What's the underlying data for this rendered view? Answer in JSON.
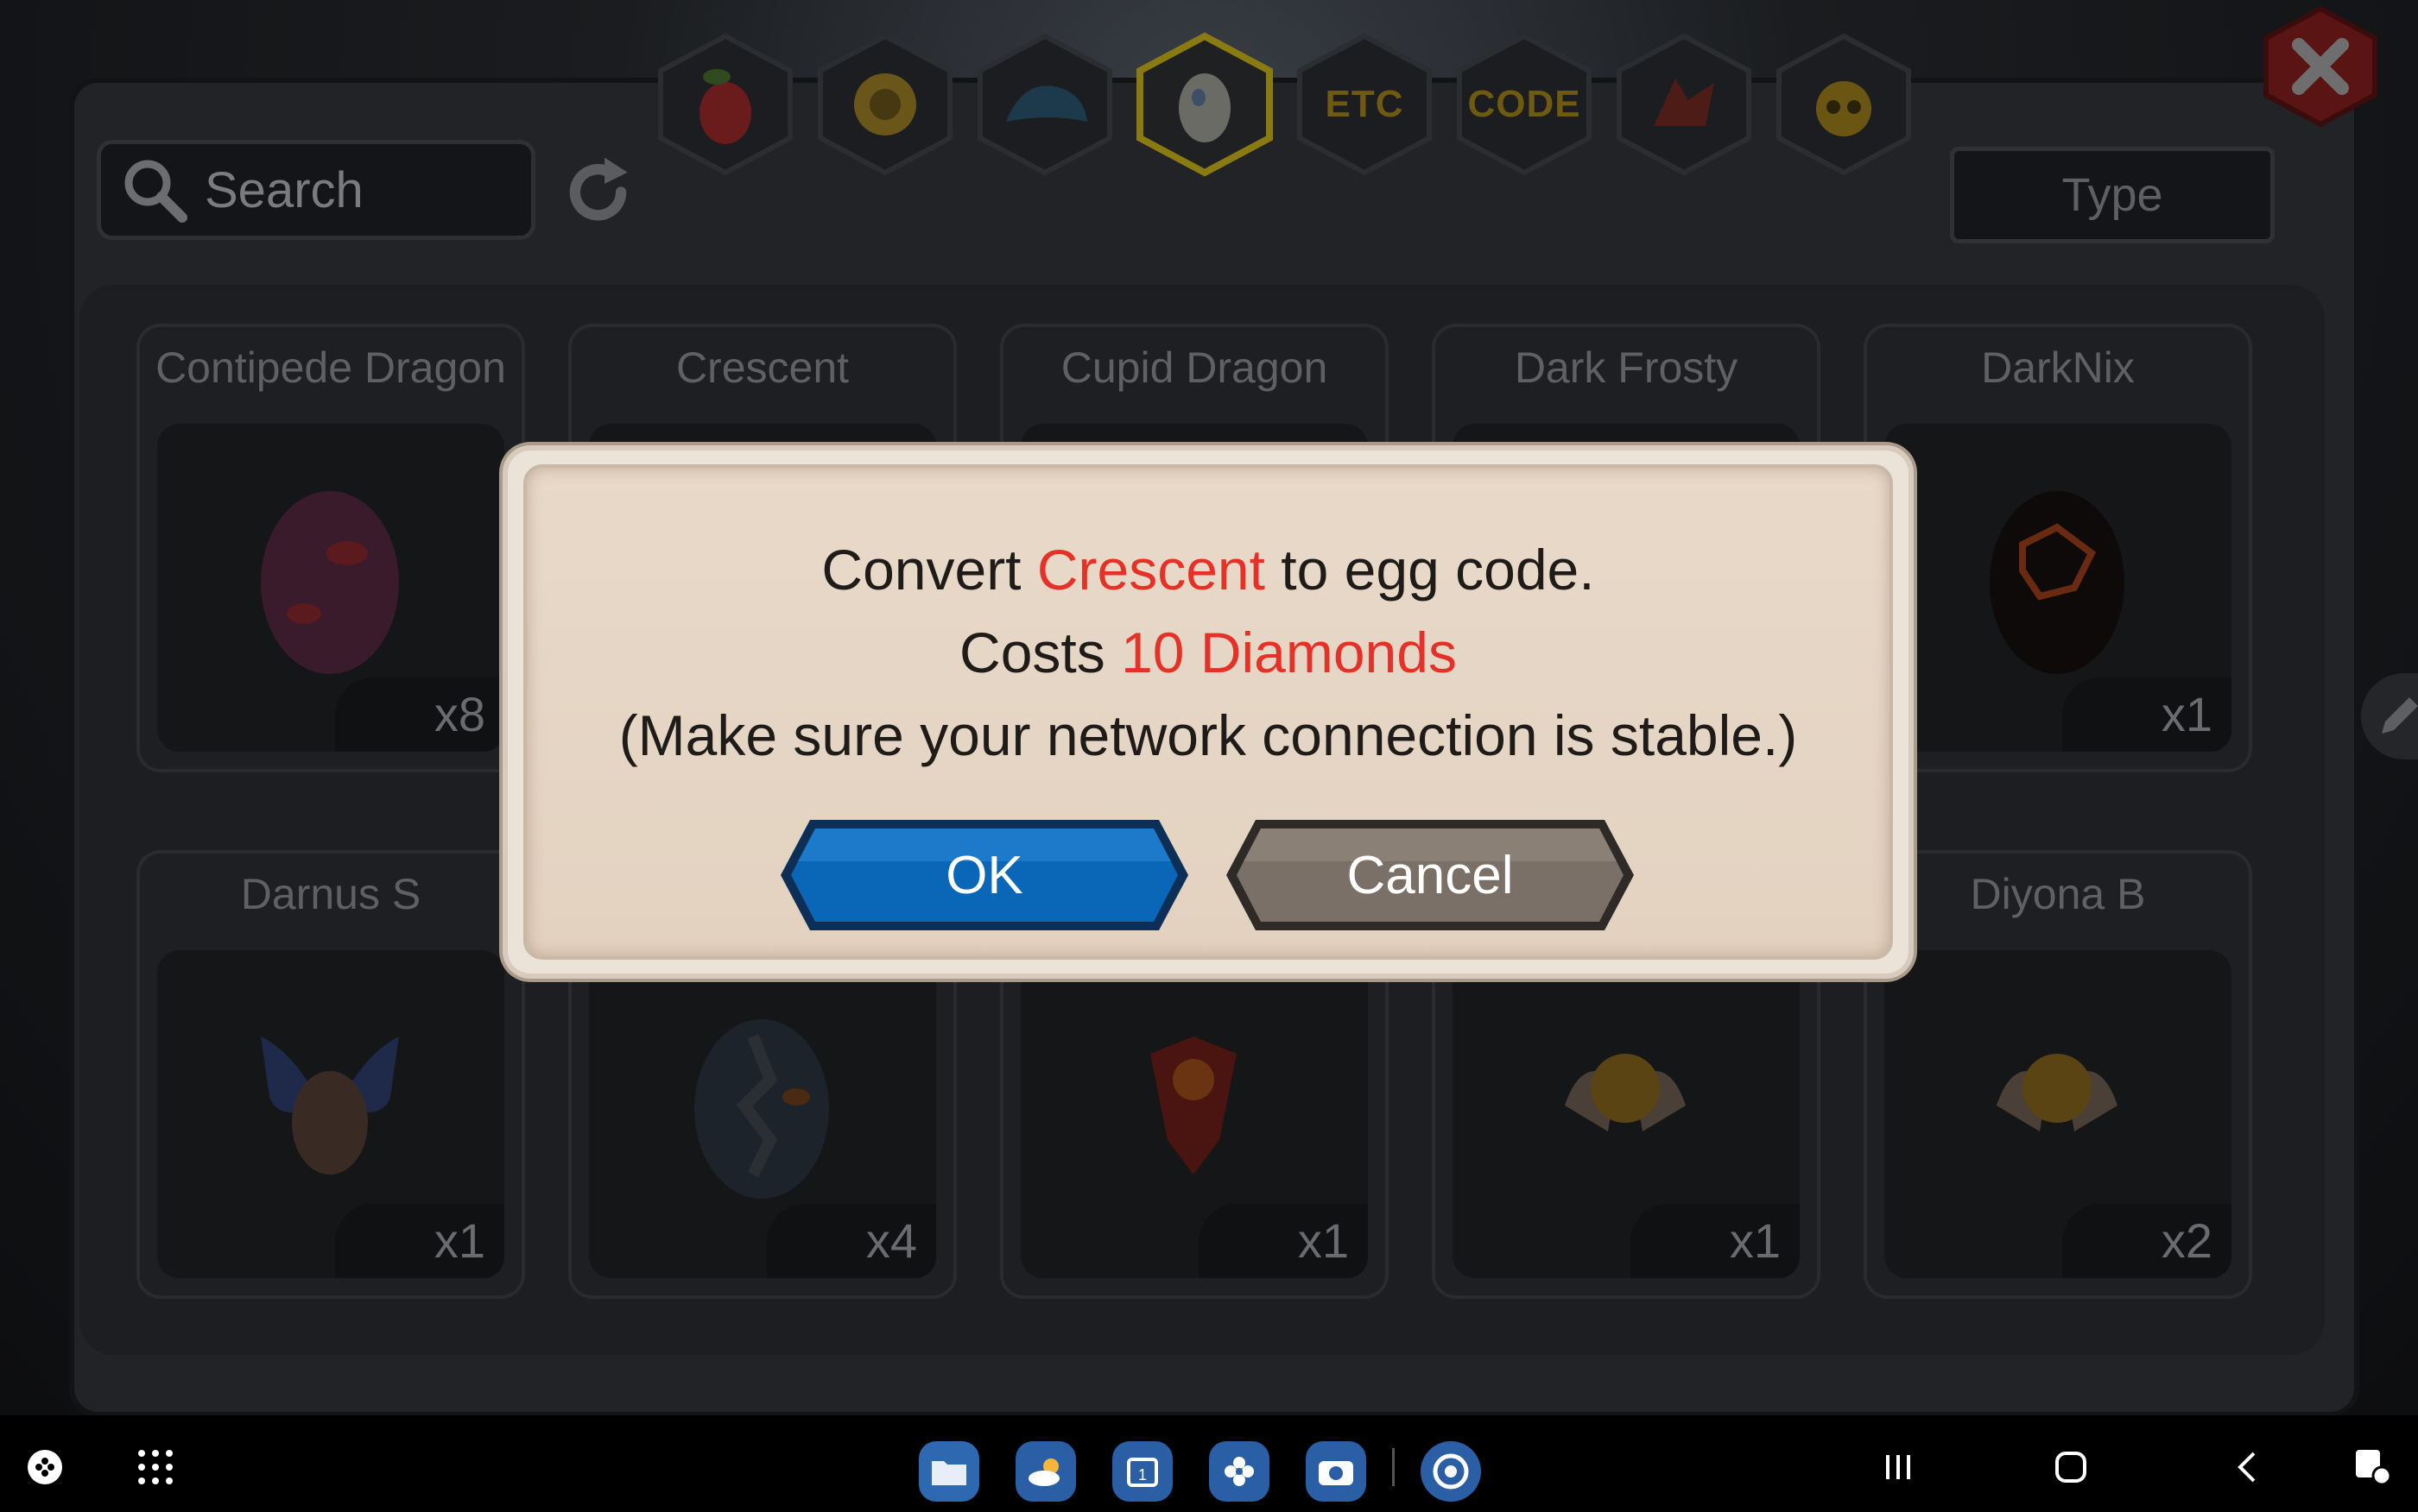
{
  "search": {
    "placeholder": "Search"
  },
  "type_filter": {
    "label": "Type"
  },
  "tabs": [
    {
      "icon": "fruit-icon",
      "label": ""
    },
    {
      "icon": "gold-orb-icon",
      "label": ""
    },
    {
      "icon": "blue-dragon-icon",
      "label": ""
    },
    {
      "icon": "egg-icon",
      "label": "",
      "selected": true
    },
    {
      "icon": "etc-icon",
      "label": "ETC"
    },
    {
      "icon": "code-icon",
      "label": "CODE"
    },
    {
      "icon": "red-dragon-icon",
      "label": ""
    },
    {
      "icon": "yellow-creature-icon",
      "label": ""
    }
  ],
  "cards_row1": [
    {
      "name": "Contipede Dragon",
      "count": "x8"
    },
    {
      "name": "Crescent",
      "count": ""
    },
    {
      "name": "Cupid Dragon",
      "count": ""
    },
    {
      "name": "Dark Frosty",
      "count": ""
    },
    {
      "name": "DarkNix",
      "count": "x1"
    }
  ],
  "cards_row2": [
    {
      "name": "Darnus S",
      "count": "x1"
    },
    {
      "name": "",
      "count": "x4"
    },
    {
      "name": "",
      "count": "x1"
    },
    {
      "name": "",
      "count": "x1"
    },
    {
      "name": "Diyona B",
      "count": "x2"
    }
  ],
  "dialog": {
    "line1_prefix": "Convert ",
    "line1_highlight": "Crescent",
    "line1_suffix": " to egg code.",
    "line2_prefix": "Costs ",
    "line2_highlight": "10 Diamonds",
    "line3": "(Make sure your network connection is stable.)",
    "ok_label": "OK",
    "cancel_label": "Cancel"
  },
  "colors": {
    "highlight": "#e53127",
    "ok_button": "#0a67b8",
    "cancel_button": "#7b7068",
    "dialog_bg": "#e8d9c9"
  }
}
